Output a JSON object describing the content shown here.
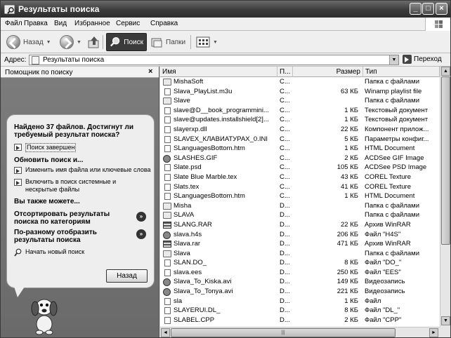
{
  "window": {
    "title": "Результаты поиска"
  },
  "menu": [
    {
      "label": "Файл"
    },
    {
      "label": "Правка"
    },
    {
      "label": "Вид"
    },
    {
      "label": "Избранное"
    },
    {
      "label": "Сервис"
    },
    {
      "label": "Справка"
    }
  ],
  "toolbar": {
    "back_label": "Назад",
    "search_label": "Поиск",
    "folders_label": "Папки"
  },
  "address": {
    "label": "Адрес:",
    "value": "Результаты поиска",
    "go_label": "Переход"
  },
  "assistant": {
    "title": "Помощник по поиску",
    "close": "×",
    "result_text": "Найдено 37 файлов. Достигнут ли требуемый результат поиска?",
    "done_label": "Поиск завершен",
    "improve_heading": "Обновить поиск и...",
    "improve_items": [
      "Изменить имя файла или ключевые слова",
      "Включить в поиск системные и нескрытые файлы"
    ],
    "also_heading": "Вы также можете...",
    "sort_label": "Отсортировать результаты поиска по категориям",
    "view_label": "По-разному отобразить результаты поиска",
    "new_search_label": "Начать новый поиск",
    "back_button": "Назад"
  },
  "columns": {
    "name": "Имя",
    "folder": "П...",
    "size": "Размер",
    "type": "Тип"
  },
  "files": [
    {
      "icon": "folder",
      "name": "MishaSoft",
      "folder": "C...",
      "size": "",
      "type": "Папка с файлами"
    },
    {
      "icon": "file",
      "name": "Slava_PlayList.m3u",
      "folder": "C...",
      "size": "63 КБ",
      "type": "Winamp playlist file"
    },
    {
      "icon": "folder",
      "name": "Slave",
      "folder": "C...",
      "size": "",
      "type": "Папка с файлами"
    },
    {
      "icon": "file",
      "name": "slave@D__book_programmini...",
      "folder": "C...",
      "size": "1 КБ",
      "type": "Текстовый документ"
    },
    {
      "icon": "file",
      "name": "slave@updates.installshield[2]...",
      "folder": "C...",
      "size": "1 КБ",
      "type": "Текстовый документ"
    },
    {
      "icon": "file",
      "name": "slayerxp.dll",
      "folder": "C...",
      "size": "22 КБ",
      "type": "Компонент прилож..."
    },
    {
      "icon": "file",
      "name": "SLAVEX_КЛАВИАТУРАХ_0.INI",
      "folder": "C...",
      "size": "5 КБ",
      "type": "Параметры конфиг..."
    },
    {
      "icon": "file",
      "name": "SLanguagesBottom.htm",
      "folder": "C...",
      "size": "1 КБ",
      "type": "HTML Document"
    },
    {
      "icon": "media",
      "name": "SLASHES.GIF",
      "folder": "C...",
      "size": "2 КБ",
      "type": "ACDSee GIF Image"
    },
    {
      "icon": "file",
      "name": "Slate.psd",
      "folder": "C...",
      "size": "105 КБ",
      "type": "ACDSee PSD Image"
    },
    {
      "icon": "file",
      "name": "Slate Blue Marble.tex",
      "folder": "C...",
      "size": "43 КБ",
      "type": "COREL Texture"
    },
    {
      "icon": "file",
      "name": "Slats.tex",
      "folder": "C...",
      "size": "41 КБ",
      "type": "COREL Texture"
    },
    {
      "icon": "file",
      "name": "SLanguagesBottom.htm",
      "folder": "C...",
      "size": "1 КБ",
      "type": "HTML Document"
    },
    {
      "icon": "folder",
      "name": "Misha",
      "folder": "D...",
      "size": "",
      "type": "Папка с файлами"
    },
    {
      "icon": "folder",
      "name": "SLAVA",
      "folder": "D...",
      "size": "",
      "type": "Папка с файлами"
    },
    {
      "icon": "archive",
      "name": "SLANG.RAR",
      "folder": "D...",
      "size": "22 КБ",
      "type": "Архив WinRAR"
    },
    {
      "icon": "media",
      "name": "slava.h4s",
      "folder": "D...",
      "size": "206 КБ",
      "type": "Файл \"H4S\""
    },
    {
      "icon": "archive",
      "name": "Slava.rar",
      "folder": "D...",
      "size": "471 КБ",
      "type": "Архив WinRAR"
    },
    {
      "icon": "folder",
      "name": "Slava",
      "folder": "D...",
      "size": "",
      "type": "Папка с файлами"
    },
    {
      "icon": "file",
      "name": "SLAN.DO_",
      "folder": "D...",
      "size": "8 КБ",
      "type": "Файл \"DO_\""
    },
    {
      "icon": "file",
      "name": "slava.ees",
      "folder": "D...",
      "size": "250 КБ",
      "type": "Файл \"EES\""
    },
    {
      "icon": "media",
      "name": "Slava_To_Kiska.avi",
      "folder": "D...",
      "size": "149 КБ",
      "type": "Видеозапись"
    },
    {
      "icon": "media",
      "name": "Slava_To_Tonya.avi",
      "folder": "D...",
      "size": "221 КБ",
      "type": "Видеозапись"
    },
    {
      "icon": "file",
      "name": "sla",
      "folder": "D...",
      "size": "1 КБ",
      "type": "Файл"
    },
    {
      "icon": "file",
      "name": "SLAYERUI.DL_",
      "folder": "D...",
      "size": "8 КБ",
      "type": "Файл \"DL_\""
    },
    {
      "icon": "file",
      "name": "SLABEL.CPP",
      "folder": "D...",
      "size": "2 КБ",
      "type": "Файл \"CPP\""
    }
  ]
}
